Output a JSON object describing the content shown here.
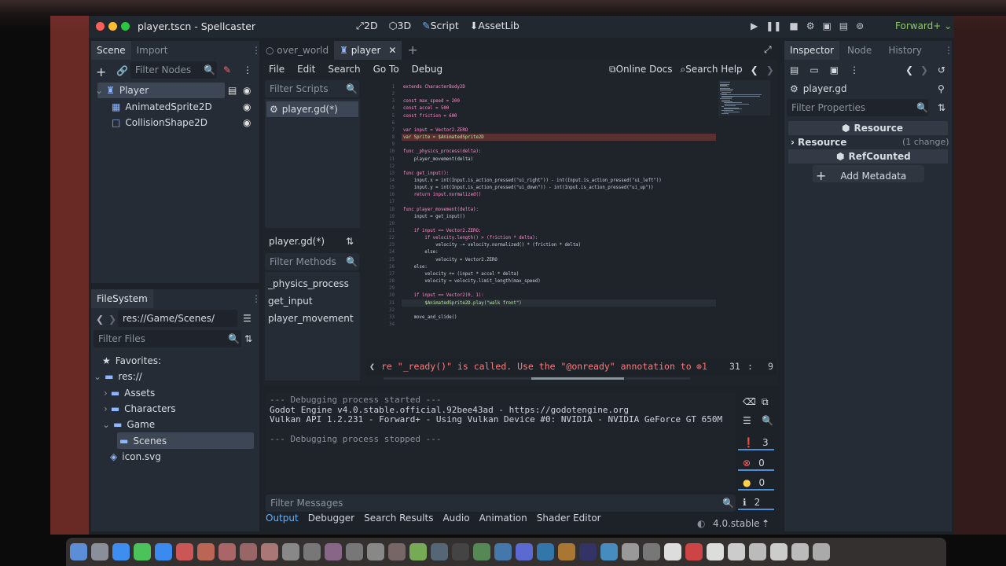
{
  "window": {
    "title": "player.tscn - Spellcaster",
    "modes": [
      "2D",
      "3D",
      "Script",
      "AssetLib"
    ],
    "active_mode": "Script",
    "renderer": "Forward+"
  },
  "scene_panel": {
    "tabs": [
      "Scene",
      "Import"
    ],
    "filter_placeholder": "Filter Nodes",
    "nodes": [
      "Player",
      "AnimatedSprite2D",
      "CollisionShape2D"
    ]
  },
  "filesystem": {
    "tab": "FileSystem",
    "path": "res://Game/Scenes/",
    "filter_placeholder": "Filter Files",
    "favorites": "Favorites:",
    "root": "res://",
    "folders": [
      "Assets",
      "Characters",
      "Game",
      "Scenes"
    ],
    "file": "icon.svg"
  },
  "editor_tabs": [
    "over_world",
    "player"
  ],
  "menu": [
    "File",
    "Edit",
    "Search",
    "Go To",
    "Debug"
  ],
  "menu_right": {
    "docs": "Online Docs",
    "help": "Search Help"
  },
  "scripts": {
    "filter_placeholder": "Filter Scripts",
    "items": [
      "player.gd(*)"
    ],
    "current": "player.gd(*)",
    "methods_placeholder": "Filter Methods",
    "methods": [
      "_physics_process",
      "get_input",
      "player_movement"
    ]
  },
  "code_lines": [
    {
      "n": "1",
      "t": "extends CharacterBody2D"
    },
    {
      "n": "2",
      "t": ""
    },
    {
      "n": "3",
      "t": "const max_speed = 200"
    },
    {
      "n": "4",
      "t": "const accel = 500"
    },
    {
      "n": "5",
      "t": "const friction = 600"
    },
    {
      "n": "6",
      "t": ""
    },
    {
      "n": "7",
      "t": "var input = Vector2.ZERO"
    },
    {
      "n": "8",
      "t": "var Sprite = $AnimatedSprite2D"
    },
    {
      "n": "9",
      "t": ""
    },
    {
      "n": "10",
      "t": "func _physics_process(delta):"
    },
    {
      "n": "11",
      "t": "    player_movement(delta)"
    },
    {
      "n": "12",
      "t": ""
    },
    {
      "n": "13",
      "t": "func get_input():"
    },
    {
      "n": "14",
      "t": "    input.x = int(Input.is_action_pressed(\"ui_right\")) - int(Input.is_action_pressed(\"ui_left\"))"
    },
    {
      "n": "15",
      "t": "    input.y = int(Input.is_action_pressed(\"ui_down\")) - int(Input.is_action_pressed(\"ui_up\"))"
    },
    {
      "n": "16",
      "t": "    return input.normalized()"
    },
    {
      "n": "17",
      "t": ""
    },
    {
      "n": "18",
      "t": "func player_movement(delta):"
    },
    {
      "n": "19",
      "t": "    input = get_input()"
    },
    {
      "n": "20",
      "t": ""
    },
    {
      "n": "21",
      "t": "    if input == Vector2.ZERO:"
    },
    {
      "n": "22",
      "t": "        if velocity.length() > (friction * delta):"
    },
    {
      "n": "23",
      "t": "            velocity -= velocity.normalized() * (friction * delta)"
    },
    {
      "n": "24",
      "t": "        else:"
    },
    {
      "n": "25",
      "t": "            velocity = Vector2.ZERO"
    },
    {
      "n": "26",
      "t": "    else:"
    },
    {
      "n": "27",
      "t": "        velocity += (input * accel * delta)"
    },
    {
      "n": "28",
      "t": "        velocity = velocity.limit_length(max_speed)"
    },
    {
      "n": "29",
      "t": ""
    },
    {
      "n": "30",
      "t": "    if input == Vector2(0, 1):"
    },
    {
      "n": "31",
      "t": "        $AnimatedSprite2D.play(\"walk front\")"
    },
    {
      "n": "32",
      "t": ""
    },
    {
      "n": "33",
      "t": "    move_and_slide()"
    },
    {
      "n": "34",
      "t": ""
    }
  ],
  "status": {
    "error_text": "re \"_ready()\" is called. Use the \"@onready\" annotation to",
    "error_count": "1",
    "line": "31",
    "col": "9"
  },
  "console": {
    "lines": [
      "--- Debugging process started ---",
      "Godot Engine v4.0.stable.official.92bee43ad - https://godotengine.org",
      "Vulkan API 1.2.231 - Forward+ - Using Vulkan Device #0: NVIDIA - NVIDIA GeForce GT 650M",
      "",
      "--- Debugging process stopped ---"
    ],
    "filter_placeholder": "Filter Messages",
    "counts": {
      "messages": "3",
      "errors": "0",
      "warnings": "0",
      "info": "2"
    }
  },
  "bottom_tabs": [
    "Output",
    "Debugger",
    "Search Results",
    "Audio",
    "Animation",
    "Shader Editor"
  ],
  "version": "4.0.stable",
  "inspector": {
    "tabs": [
      "Inspector",
      "Node",
      "History"
    ],
    "object": "player.gd",
    "filter_placeholder": "Filter Properties",
    "resource_header": "Resource",
    "resource_row": "Resource",
    "change": "(1 change)",
    "refcounted": "RefCounted",
    "add_metadata": "Add Metadata"
  }
}
